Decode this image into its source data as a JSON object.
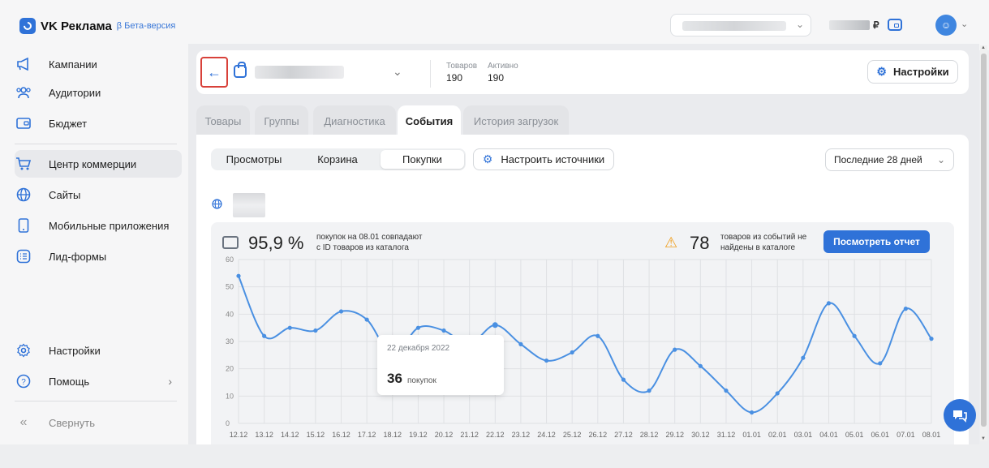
{
  "app": {
    "name": "VK Реклама",
    "beta": "β Бета-версия",
    "currency": "₽"
  },
  "sidebar": {
    "items": [
      {
        "label": "Кампании",
        "icon": "megaphone-icon"
      },
      {
        "label": "Аудитории",
        "icon": "users-icon"
      },
      {
        "label": "Бюджет",
        "icon": "wallet-icon"
      },
      {
        "label": "Центр коммерции",
        "icon": "cart-icon",
        "active": true
      },
      {
        "label": "Сайты",
        "icon": "globe-icon"
      },
      {
        "label": "Мобильные приложения",
        "icon": "phone-icon"
      },
      {
        "label": "Лид-формы",
        "icon": "form-icon"
      }
    ],
    "settings": "Настройки",
    "help": "Помощь",
    "collapse": "Свернуть"
  },
  "header": {
    "products_label": "Товаров",
    "products_value": "190",
    "active_label": "Активно",
    "active_value": "190",
    "settings_btn": "Настройки"
  },
  "tabs": [
    "Товары",
    "Группы",
    "Диагностика",
    "События",
    "История загрузок"
  ],
  "active_tab": "События",
  "subtabs": [
    "Просмотры",
    "Корзина",
    "Покупки"
  ],
  "active_subtab": "Покупки",
  "sources_btn": "Настроить источники",
  "period": "Последние 28 дней",
  "kpi": {
    "match_value": "95,9 %",
    "match_text_1": "покупок на 08.01 совпадают",
    "match_text_2": "с ID товаров из каталога",
    "missing_value": "78",
    "missing_text_1": "товаров из событий не",
    "missing_text_2": "найдены в каталоге",
    "report_btn": "Посмотреть отчет"
  },
  "tooltip": {
    "date": "22 декабря 2022",
    "value": "36",
    "unit": "покупок"
  },
  "colors": {
    "accent": "#2f72d8",
    "line": "#4a90e2"
  },
  "chart_data": {
    "type": "line",
    "x": [
      "12.12",
      "13.12",
      "14.12",
      "15.12",
      "16.12",
      "17.12",
      "18.12",
      "19.12",
      "20.12",
      "21.12",
      "22.12",
      "23.12",
      "24.12",
      "25.12",
      "26.12",
      "27.12",
      "28.12",
      "29.12",
      "30.12",
      "31.12",
      "01.01",
      "02.01",
      "03.01",
      "04.01",
      "05.01",
      "06.01",
      "07.01",
      "08.01"
    ],
    "series": [
      {
        "values": [
          54,
          32,
          35,
          34,
          41,
          38,
          25,
          35,
          34,
          29,
          36,
          29,
          23,
          26,
          32,
          16,
          12,
          27,
          21,
          12,
          4,
          11,
          24,
          44,
          32,
          22,
          42,
          31
        ]
      }
    ],
    "ylim": [
      0,
      60
    ],
    "yticks": [
      0,
      10,
      20,
      30,
      40,
      50,
      60
    ],
    "grid": true
  }
}
